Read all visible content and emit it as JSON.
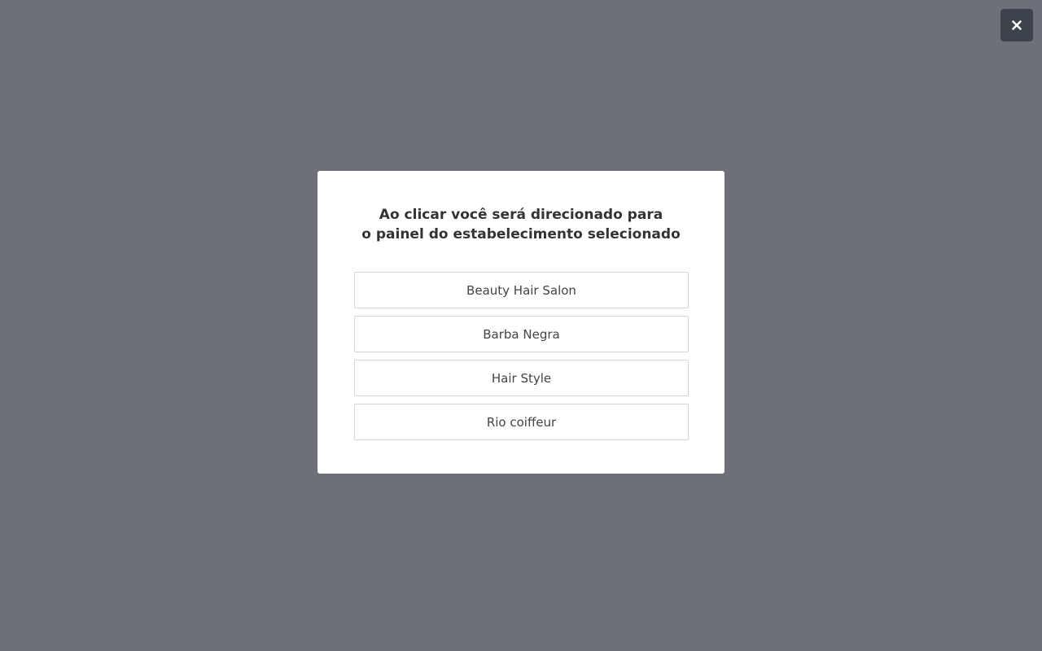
{
  "close_button": {
    "icon": "close-icon",
    "color": "#ffffff",
    "background": "#3d434d"
  },
  "overlay": {
    "background": "#6d7079"
  },
  "modal": {
    "title_line1": "Ao clicar você será direcionado para",
    "title_line2": "o painel do estabelecimento selecionado",
    "establishments": [
      {
        "label": "Beauty Hair Salon"
      },
      {
        "label": "Barba Negra"
      },
      {
        "label": "Hair Style"
      },
      {
        "label": "Rio coiffeur"
      }
    ]
  }
}
